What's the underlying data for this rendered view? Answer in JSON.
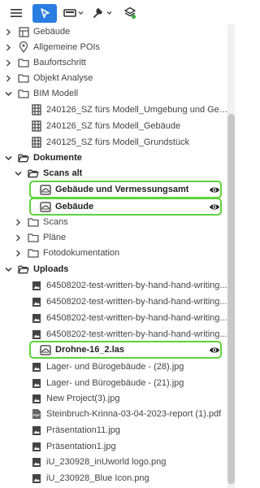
{
  "toolbar": {
    "menu_icon": "hamburger-icon",
    "select_icon": "cursor-arrow-icon",
    "shape_icon": "rectangle-dropdown-icon",
    "tools_icon": "wrench-dropdown-icon",
    "layers_icon": "layers-icon",
    "accent": "#2a7de1"
  },
  "tree": {
    "items": [
      {
        "label": "Gebäude",
        "icon": "building-grid-icon"
      },
      {
        "label": "Allgemeine POIs",
        "icon": "map-pin-icon"
      },
      {
        "label": "Baufortschritt",
        "icon": "folder-icon"
      },
      {
        "label": "Objekt Analyse",
        "icon": "folder-icon"
      },
      {
        "label": "BIM Modell",
        "icon": "folder-icon"
      },
      {
        "label": "240126_SZ fürs Modell_Umgebung und Gebäude",
        "icon": "bim-model-icon"
      },
      {
        "label": "240126_SZ fürs Modell_Gebäude",
        "icon": "bim-model-icon"
      },
      {
        "label": "240125_SZ fürs Modell_Grundstück",
        "icon": "bim-model-icon"
      },
      {
        "label": "Dokumente",
        "icon": "folder-open-icon"
      },
      {
        "label": "Scans alt",
        "icon": "folder-open-icon"
      },
      {
        "label": "Gebäude und Vermessungsamt",
        "icon": "scan-cloud-icon"
      },
      {
        "label": "Gebäude",
        "icon": "scan-cloud-icon"
      },
      {
        "label": "Scans",
        "icon": "folder-icon"
      },
      {
        "label": "Pläne",
        "icon": "folder-icon"
      },
      {
        "label": "Fotodokumentation",
        "icon": "folder-icon"
      },
      {
        "label": "Uploads",
        "icon": "folder-open-icon"
      },
      {
        "label": "64508202-test-written-by-hand-hand-writing...",
        "icon": "image-file-icon"
      },
      {
        "label": "64508202-test-written-by-hand-hand-writing...",
        "icon": "image-file-icon"
      },
      {
        "label": "64508202-test-written-by-hand-hand-writing...",
        "icon": "image-file-icon"
      },
      {
        "label": "64508202-test-written-by-hand-hand-writing...",
        "icon": "image-file-icon"
      },
      {
        "label": "Drohne-16_2.las",
        "icon": "scan-cloud-icon"
      },
      {
        "label": "Lager- und Bürogebäude -  (28).jpg",
        "icon": "image-file-icon"
      },
      {
        "label": "Lager- und Bürogebäude -  (21).jpg",
        "icon": "image-file-icon"
      },
      {
        "label": "New Project(3).jpg",
        "icon": "image-file-icon"
      },
      {
        "label": "Steinbruch-Krinna-03-04-2023-report (1).pdf",
        "icon": "pdf-file-icon"
      },
      {
        "label": "Präsentation11.jpg",
        "icon": "image-file-icon"
      },
      {
        "label": "Präsentation1.jpg",
        "icon": "image-file-icon"
      },
      {
        "label": "iU_230928_inUworld logo.png",
        "icon": "image-file-icon"
      },
      {
        "label": "iU_230928_Blue Icon.png",
        "icon": "image-file-icon"
      }
    ],
    "highlight_color": "#5fd23d",
    "visibility_icon": "eye-icon"
  }
}
